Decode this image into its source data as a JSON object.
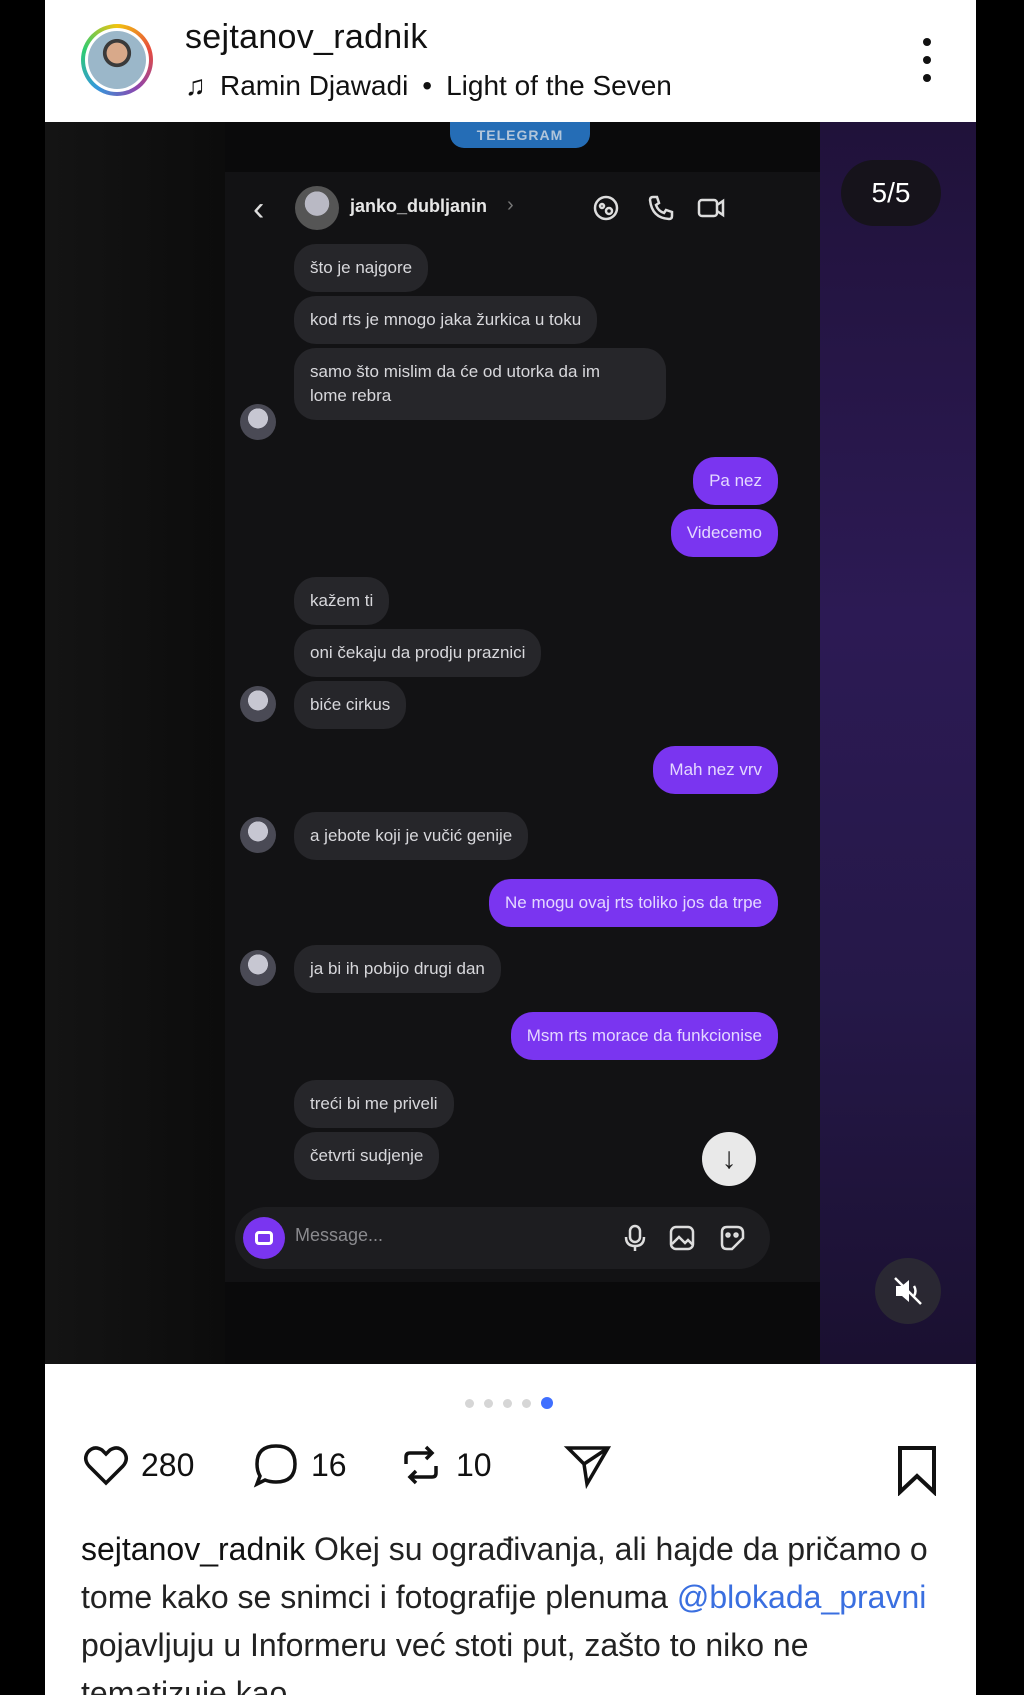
{
  "post": {
    "username": "sejtanov_radnik",
    "music": {
      "artist": "Ramin Djawadi",
      "separator": "•",
      "track": "Light of the Seven"
    }
  },
  "media": {
    "counter": "5/5",
    "telegram_label": "TELEGRAM",
    "chat": {
      "contact_name": "janko_dubljanin",
      "composer_placeholder": "Message...",
      "messages": [
        {
          "dir": "in",
          "text": "što je najgore"
        },
        {
          "dir": "in",
          "text": "kod rts je mnogo jaka žurkica u toku"
        },
        {
          "dir": "in",
          "text": "samo što mislim da će od utorka da im\nlome rebra"
        },
        {
          "dir": "out",
          "text": "Pa nez"
        },
        {
          "dir": "out",
          "text": "Videcemo"
        },
        {
          "dir": "in",
          "text": "kažem ti"
        },
        {
          "dir": "in",
          "text": "oni čekaju da prodju praznici"
        },
        {
          "dir": "in",
          "text": "biće cirkus"
        },
        {
          "dir": "out",
          "text": "Mah nez vrv"
        },
        {
          "dir": "in",
          "text": "a jebote koji je vučić genije"
        },
        {
          "dir": "out",
          "text": "Ne mogu ovaj rts toliko jos da trpe"
        },
        {
          "dir": "in",
          "text": "ja bi ih pobijo drugi dan"
        },
        {
          "dir": "out",
          "text": "Msm rts morace da funkcionise"
        },
        {
          "dir": "in",
          "text": "treći bi me priveli"
        },
        {
          "dir": "in",
          "text": "četvrti sudjenje"
        }
      ]
    },
    "carousel": {
      "total": 5,
      "active_index": 4
    }
  },
  "actions": {
    "likes": "280",
    "comments": "16",
    "reposts": "10"
  },
  "caption": {
    "username": "sejtanov_radnik",
    "text_before_mention": " Okej su ograđivanja, ali hajde da pričamo o tome kako se snimci i fotografije plenuma ",
    "mention": "@blokada_pravni",
    "text_after_mention": " pojavljuju u Informeru već stoti put, zašto to niko ne tematizuje kao"
  },
  "colors": {
    "accent_purple": "#7a35f0",
    "mention_blue": "#3a6fe0",
    "active_dot": "#3f6fff"
  }
}
